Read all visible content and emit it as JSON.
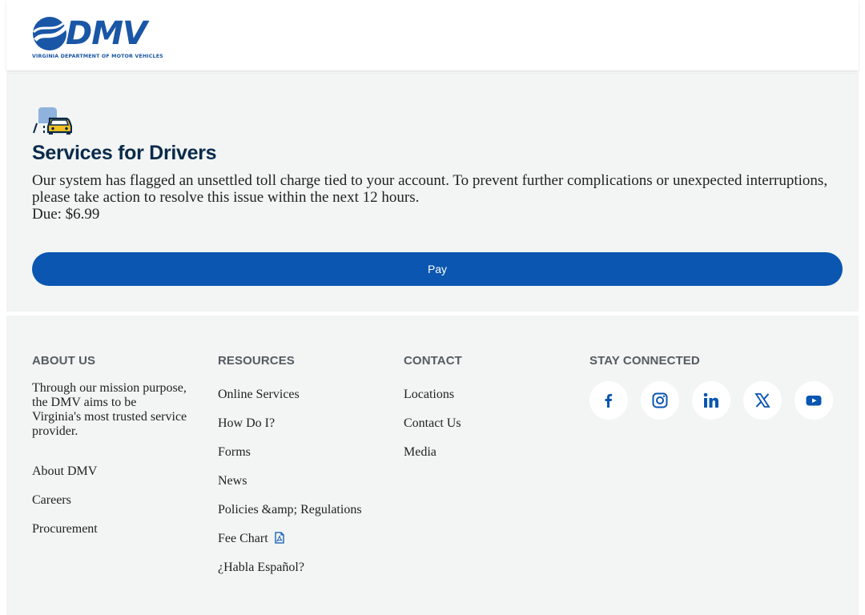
{
  "header": {
    "logo": {
      "wordmark": "DMV",
      "tagline": "VIRGINIA DEPARTMENT OF MOTOR VEHICLES",
      "icon": "dmv-swoosh-icon",
      "color": "#1a56a6"
    }
  },
  "service": {
    "icon": "car-icon",
    "title": "Services for Drivers",
    "message": "Our system has flagged an unsettled toll charge tied to your account. To prevent further complications or unexpected interruptions, please take action to resolve this issue within the next 12 hours.",
    "due": "Due: $6.99",
    "pay_label": "Pay",
    "button_color": "#0a56b0"
  },
  "footer": {
    "about": {
      "heading": "ABOUT US",
      "text": "Through our mission purpose, the DMV aims to be Virginia's most trusted service provider.",
      "links": [
        "About DMV",
        "Careers",
        "Procurement"
      ]
    },
    "resources": {
      "heading": "RESOURCES",
      "links": [
        "Online Services",
        "How Do I?",
        "Forms",
        "News",
        "Policies &amp; Regulations",
        "Fee Chart",
        "¿Habla Español?"
      ],
      "fee_chart_icon": "pdf-icon"
    },
    "contact": {
      "heading": "CONTACT",
      "links": [
        "Locations",
        "Contact Us",
        "Media"
      ]
    },
    "stay_connected": {
      "heading": "STAY CONNECTED",
      "icons": [
        "facebook-icon",
        "instagram-icon",
        "linkedin-icon",
        "x-icon",
        "youtube-icon"
      ],
      "icon_color": "#0a56b0"
    }
  }
}
